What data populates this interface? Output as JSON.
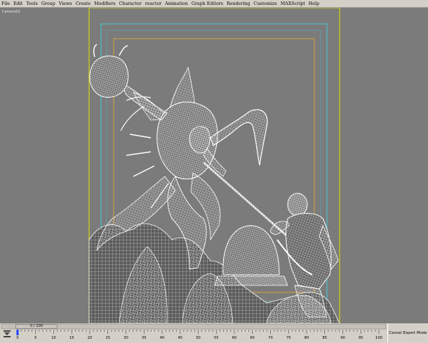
{
  "menu": [
    "File",
    "Edit",
    "Tools",
    "Group",
    "Views",
    "Create",
    "Modifiers",
    "Character",
    "reactor",
    "Animation",
    "Graph Editors",
    "Rendering",
    "Customize",
    "MAXScript",
    "Help"
  ],
  "viewport": {
    "label": "Camera01"
  },
  "timeline": {
    "slider_label": "0 / 100",
    "ticks": [
      "0",
      "5",
      "10",
      "15",
      "20",
      "25",
      "30",
      "35",
      "40",
      "45",
      "50",
      "55",
      "60",
      "65",
      "70",
      "75",
      "80",
      "85",
      "90",
      "95",
      "100"
    ]
  },
  "expert_button": "Cancel Expert Mode",
  "colors": {
    "viewport_bg": "#7b7b7b",
    "safe_frame_outer": "#e6e600",
    "safe_frame_action": "#40c8d8",
    "safe_frame_title": "#d8a040",
    "wireframe": "#ffffff"
  }
}
